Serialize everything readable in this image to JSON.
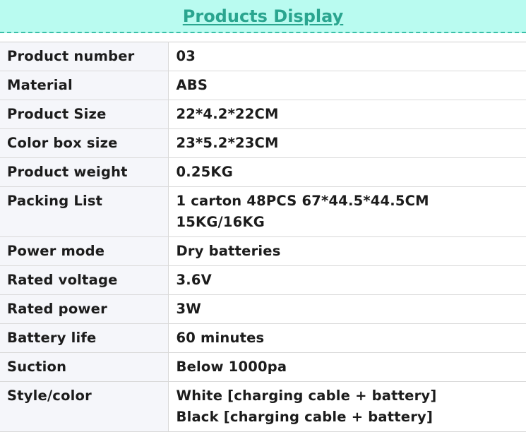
{
  "header": {
    "title": "Products Display"
  },
  "specs": [
    {
      "label": "Product number",
      "value": [
        "03"
      ]
    },
    {
      "label": "Material",
      "value": [
        "ABS"
      ]
    },
    {
      "label": "Product Size",
      "value": [
        "22*4.2*22CM"
      ]
    },
    {
      "label": "Color box size",
      "value": [
        "23*5.2*23CM"
      ]
    },
    {
      "label": "Product weight",
      "value": [
        "0.25KG"
      ]
    },
    {
      "label": "Packing List",
      "value": [
        "1 carton 48PCS 67*44.5*44.5CM",
        "15KG/16KG"
      ]
    },
    {
      "label": "Power mode",
      "value": [
        "Dry batteries"
      ]
    },
    {
      "label": "Rated voltage",
      "value": [
        "3.6V"
      ]
    },
    {
      "label": "Rated power",
      "value": [
        "3W"
      ]
    },
    {
      "label": "Battery life",
      "value": [
        "60 minutes"
      ]
    },
    {
      "label": "Suction",
      "value": [
        "Below 1000pa"
      ]
    },
    {
      "label": "Style/color",
      "value": [
        "White [charging cable + battery]",
        "Black [charging cable + battery]"
      ]
    }
  ]
}
